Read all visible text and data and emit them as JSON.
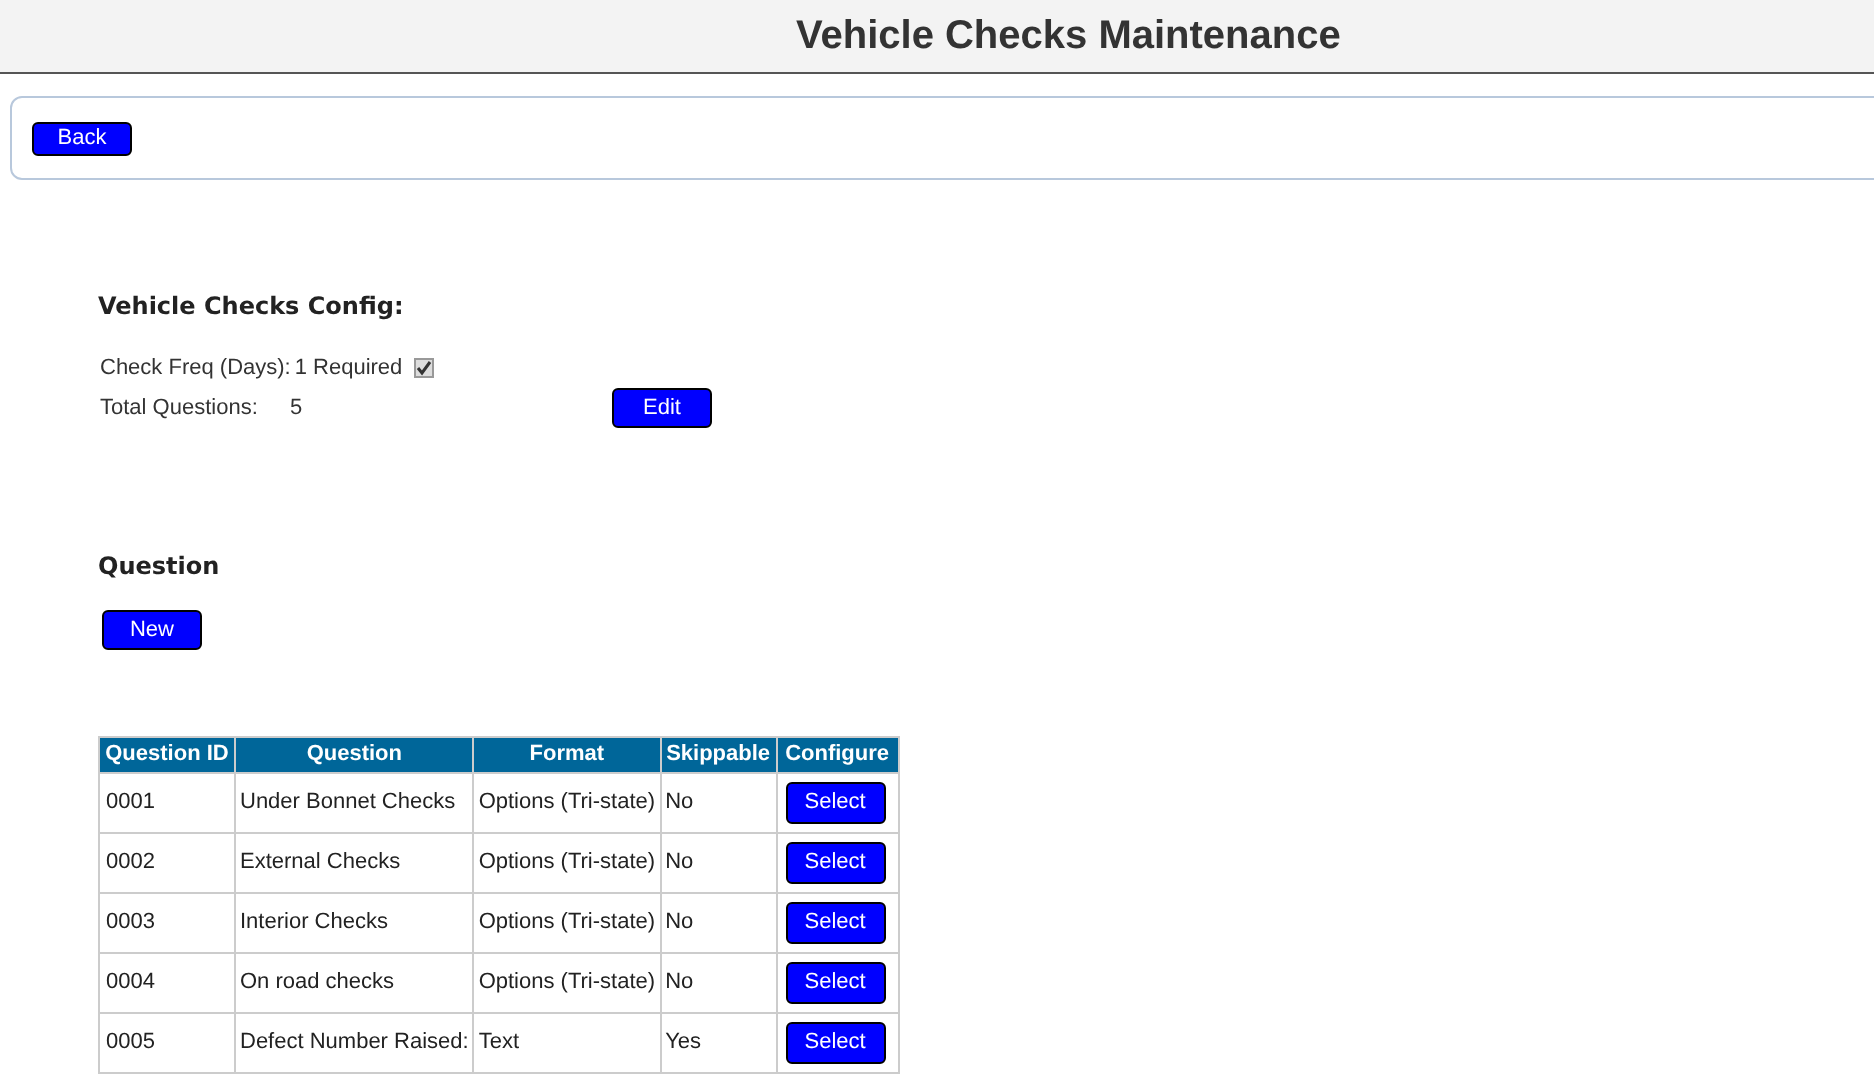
{
  "page_title": "Vehicle Checks Maintenance",
  "toolbar": {
    "back_button": "Back"
  },
  "config": {
    "heading": "Vehicle Checks Config:",
    "freq_label": "Check Freq (Days):",
    "freq_value": "1 Required",
    "required_checked": true,
    "total_label": "Total Questions:",
    "total_value": "5",
    "edit_button": "Edit"
  },
  "questions": {
    "heading": "Question",
    "new_button": "New",
    "table": {
      "columns": [
        "Question ID",
        "Question",
        "Format",
        "Skippable",
        "Configure"
      ],
      "rows": [
        {
          "id": "0001",
          "question": "Under Bonnet Checks",
          "format": "Options (Tri-state)",
          "skippable": "No",
          "action": "Select"
        },
        {
          "id": "0002",
          "question": "External Checks",
          "format": "Options (Tri-state)",
          "skippable": "No",
          "action": "Select"
        },
        {
          "id": "0003",
          "question": "Interior Checks",
          "format": "Options (Tri-state)",
          "skippable": "No",
          "action": "Select"
        },
        {
          "id": "0004",
          "question": "On road checks",
          "format": "Options (Tri-state)",
          "skippable": "No",
          "action": "Select"
        },
        {
          "id": "0005",
          "question": "Defect Number Raised:",
          "format": "Text",
          "skippable": "Yes",
          "action": "Select"
        }
      ]
    }
  }
}
